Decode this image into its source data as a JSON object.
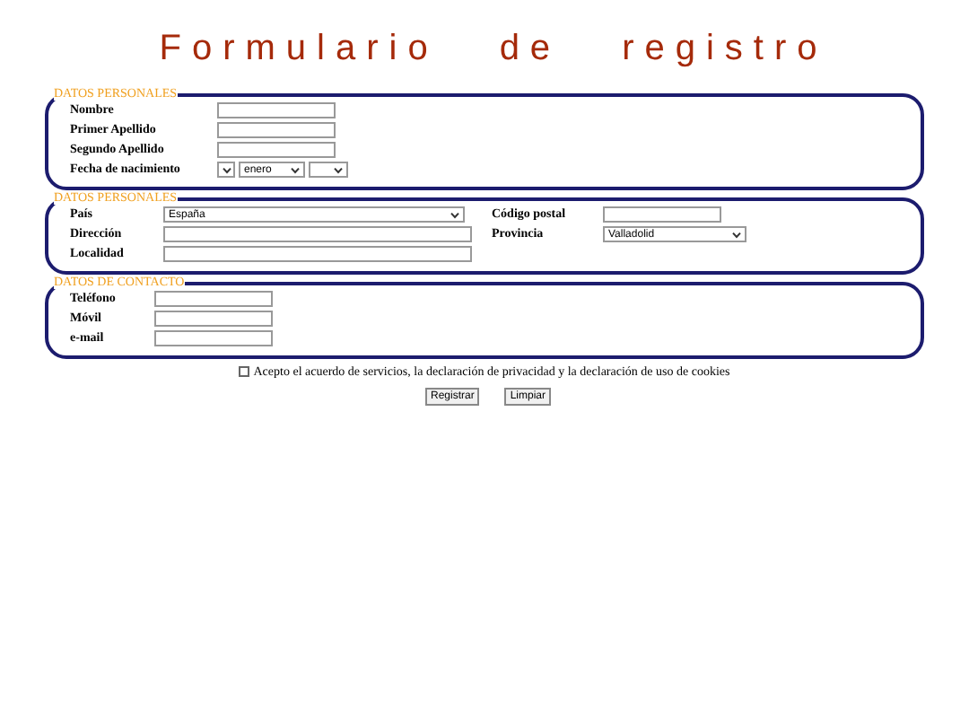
{
  "title": [
    "Formulario",
    "de",
    "registro"
  ],
  "sections": [
    {
      "legend": "DATOS PERSONALES",
      "columns": [
        [
          {
            "label": "Nombre",
            "kind": "text"
          },
          {
            "label": "Primer Apellido",
            "kind": "text"
          },
          {
            "label": "Segundo Apellido",
            "kind": "text"
          },
          {
            "label": "Fecha de nacimiento",
            "kind": "date",
            "month": "enero"
          }
        ]
      ]
    },
    {
      "legend": "DATOS PERSONALES",
      "columns": [
        [
          {
            "label": "País",
            "kind": "select",
            "value": "España"
          },
          {
            "label": "Dirección",
            "kind": "text"
          },
          {
            "label": "Localidad",
            "kind": "text"
          }
        ],
        [
          {
            "label": "Código postal",
            "kind": "text"
          },
          {
            "label": "Provincia",
            "kind": "select",
            "value": "Valladolid"
          }
        ]
      ]
    },
    {
      "legend": "DATOS DE CONTACTO",
      "columns": [
        [
          {
            "label": "Teléfono",
            "kind": "text"
          },
          {
            "label": "Móvil",
            "kind": "text"
          },
          {
            "label": "e-mail",
            "kind": "text"
          }
        ]
      ]
    }
  ],
  "agreement": {
    "label": "Acepto el acuerdo de servicios, la declaración de privacidad y la declaración de uso de cookies",
    "checked": false
  },
  "buttons": [
    "Registrar",
    "Limpiar"
  ]
}
